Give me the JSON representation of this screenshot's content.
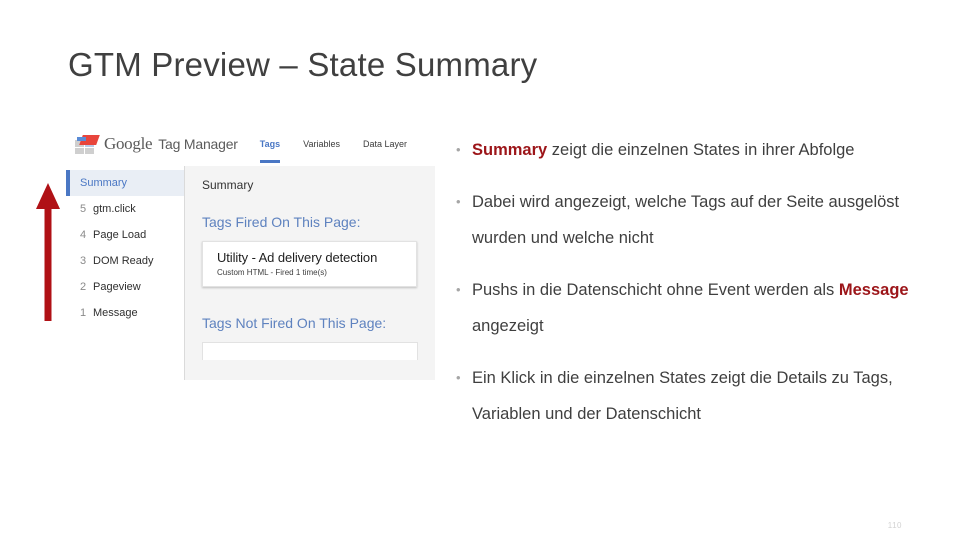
{
  "slide": {
    "title": "GTM Preview – State Summary",
    "page_number": "110",
    "accent_red": "#9c1519",
    "arrow_color": "#b01116",
    "title_color": "#404040"
  },
  "screenshot": {
    "header": {
      "logo_icon": "google-tag-manager-logo-icon",
      "wordmark": "Google",
      "product_name": "Tag Manager",
      "tabs": [
        {
          "label": "Tags",
          "active": true
        },
        {
          "label": "Variables",
          "active": false
        },
        {
          "label": "Data Layer",
          "active": false
        }
      ],
      "active_tab_color": "#4a77c4"
    },
    "sidebar": {
      "items": [
        {
          "index": "",
          "label": "Summary",
          "selected": true
        },
        {
          "index": "5",
          "label": "gtm.click",
          "selected": false
        },
        {
          "index": "4",
          "label": "Page Load",
          "selected": false
        },
        {
          "index": "3",
          "label": "DOM Ready",
          "selected": false
        },
        {
          "index": "2",
          "label": "Pageview",
          "selected": false
        },
        {
          "index": "1",
          "label": "Message",
          "selected": false
        }
      ]
    },
    "main": {
      "title": "Summary",
      "fired_heading": "Tags Fired On This Page:",
      "fired_tag": {
        "name": "Utility - Ad delivery detection",
        "meta": "Custom HTML - Fired 1 time(s)"
      },
      "not_fired_heading": "Tags Not Fired On This Page:"
    }
  },
  "bullets": [
    {
      "marker": "•",
      "parts": [
        {
          "text": "Summary",
          "bold": true
        },
        {
          "text": " zeigt die einzelnen States in ihrer Abfolge",
          "bold": false
        }
      ]
    },
    {
      "marker": "•",
      "parts": [
        {
          "text": "Dabei wird angezeigt, welche Tags auf der Seite ausgelöst wurden und welche nicht",
          "bold": false
        }
      ]
    },
    {
      "marker": "•",
      "parts": [
        {
          "text": "Pushs in die Datenschicht ohne Event werden als ",
          "bold": false
        },
        {
          "text": "Message",
          "bold": true
        },
        {
          "text": " angezeigt",
          "bold": false
        }
      ]
    },
    {
      "marker": "•",
      "parts": [
        {
          "text": "Ein Klick in die einzelnen States zeigt die Details zu Tags, Variablen und der Datenschicht",
          "bold": false
        }
      ]
    }
  ]
}
